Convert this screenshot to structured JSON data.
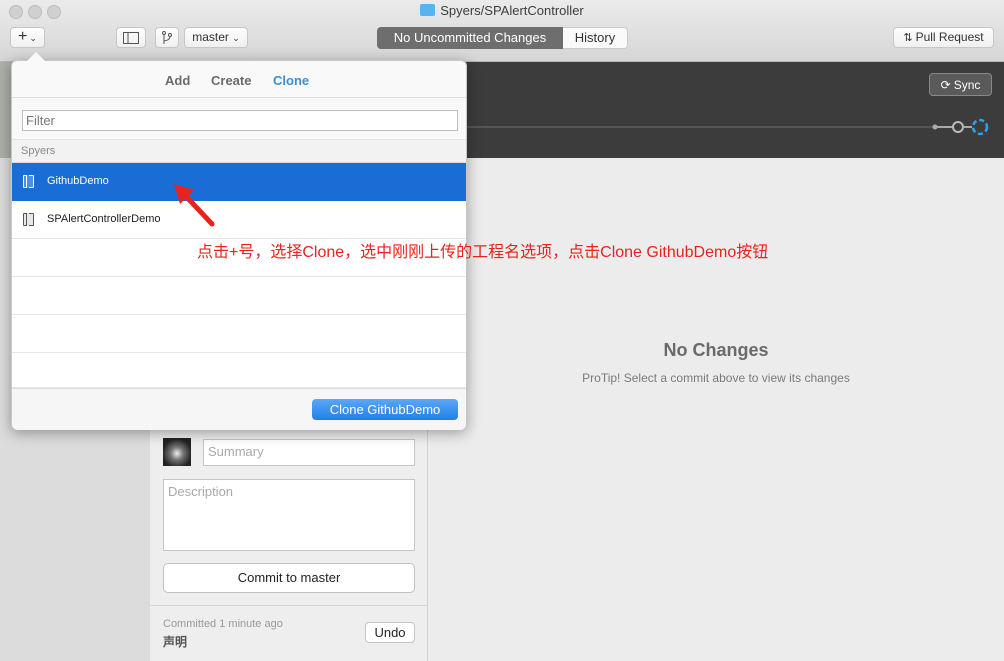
{
  "window": {
    "title": "Spyers/SPAlertController"
  },
  "toolbar": {
    "add_symbol": "+",
    "branch": "master",
    "segments": [
      "No Uncommitted Changes",
      "History"
    ],
    "pull_request": "Pull Request"
  },
  "main": {
    "sync_label": "Sync",
    "no_changes_title": "No Changes",
    "no_changes_tip": "ProTip! Select a commit above to view its changes"
  },
  "commit": {
    "summary_placeholder": "Summary",
    "description_placeholder": "Description",
    "commit_button": "Commit to master",
    "last_commit_time": "Committed 1 minute ago",
    "last_commit_message": "声明",
    "undo_label": "Undo"
  },
  "popover": {
    "tabs": [
      "Add",
      "Create",
      "Clone"
    ],
    "active_tab": "Clone",
    "filter_placeholder": "Filter",
    "group_label": "Spyers",
    "repos": [
      "GithubDemo",
      "SPAlertControllerDemo"
    ],
    "selected_repo": "GithubDemo",
    "clone_button": "Clone GithubDemo"
  },
  "annotation": {
    "text": "点击+号，选择Clone，选中刚刚上传的工程名选项，点击Clone GithubDemo按钮",
    "color": "#e6231f"
  },
  "colors": {
    "accent": "#1a6dd4",
    "clone_tab": "#3a8ed6"
  }
}
